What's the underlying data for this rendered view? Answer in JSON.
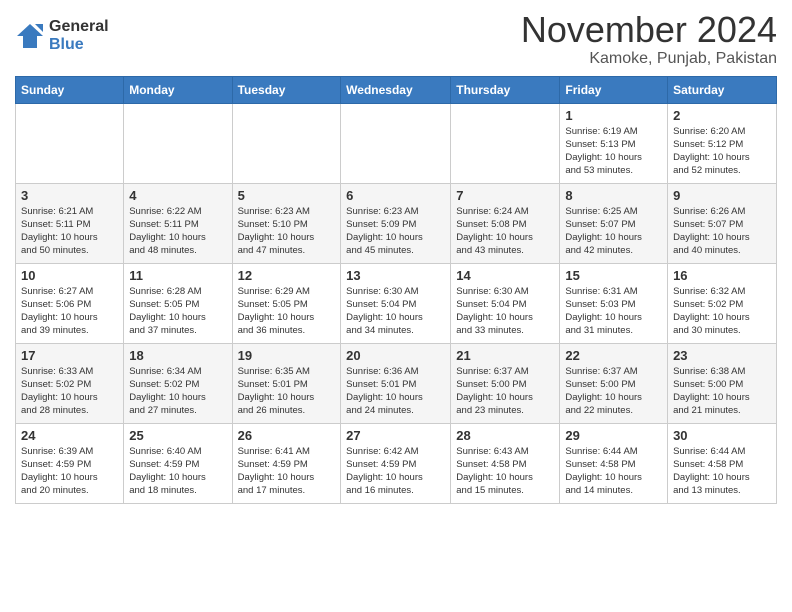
{
  "header": {
    "logo_general": "General",
    "logo_blue": "Blue",
    "month_title": "November 2024",
    "location": "Kamoke, Punjab, Pakistan"
  },
  "calendar": {
    "headers": [
      "Sunday",
      "Monday",
      "Tuesday",
      "Wednesday",
      "Thursday",
      "Friday",
      "Saturday"
    ],
    "rows": [
      [
        {
          "day": "",
          "info": ""
        },
        {
          "day": "",
          "info": ""
        },
        {
          "day": "",
          "info": ""
        },
        {
          "day": "",
          "info": ""
        },
        {
          "day": "",
          "info": ""
        },
        {
          "day": "1",
          "info": "Sunrise: 6:19 AM\nSunset: 5:13 PM\nDaylight: 10 hours\nand 53 minutes."
        },
        {
          "day": "2",
          "info": "Sunrise: 6:20 AM\nSunset: 5:12 PM\nDaylight: 10 hours\nand 52 minutes."
        }
      ],
      [
        {
          "day": "3",
          "info": "Sunrise: 6:21 AM\nSunset: 5:11 PM\nDaylight: 10 hours\nand 50 minutes."
        },
        {
          "day": "4",
          "info": "Sunrise: 6:22 AM\nSunset: 5:11 PM\nDaylight: 10 hours\nand 48 minutes."
        },
        {
          "day": "5",
          "info": "Sunrise: 6:23 AM\nSunset: 5:10 PM\nDaylight: 10 hours\nand 47 minutes."
        },
        {
          "day": "6",
          "info": "Sunrise: 6:23 AM\nSunset: 5:09 PM\nDaylight: 10 hours\nand 45 minutes."
        },
        {
          "day": "7",
          "info": "Sunrise: 6:24 AM\nSunset: 5:08 PM\nDaylight: 10 hours\nand 43 minutes."
        },
        {
          "day": "8",
          "info": "Sunrise: 6:25 AM\nSunset: 5:07 PM\nDaylight: 10 hours\nand 42 minutes."
        },
        {
          "day": "9",
          "info": "Sunrise: 6:26 AM\nSunset: 5:07 PM\nDaylight: 10 hours\nand 40 minutes."
        }
      ],
      [
        {
          "day": "10",
          "info": "Sunrise: 6:27 AM\nSunset: 5:06 PM\nDaylight: 10 hours\nand 39 minutes."
        },
        {
          "day": "11",
          "info": "Sunrise: 6:28 AM\nSunset: 5:05 PM\nDaylight: 10 hours\nand 37 minutes."
        },
        {
          "day": "12",
          "info": "Sunrise: 6:29 AM\nSunset: 5:05 PM\nDaylight: 10 hours\nand 36 minutes."
        },
        {
          "day": "13",
          "info": "Sunrise: 6:30 AM\nSunset: 5:04 PM\nDaylight: 10 hours\nand 34 minutes."
        },
        {
          "day": "14",
          "info": "Sunrise: 6:30 AM\nSunset: 5:04 PM\nDaylight: 10 hours\nand 33 minutes."
        },
        {
          "day": "15",
          "info": "Sunrise: 6:31 AM\nSunset: 5:03 PM\nDaylight: 10 hours\nand 31 minutes."
        },
        {
          "day": "16",
          "info": "Sunrise: 6:32 AM\nSunset: 5:02 PM\nDaylight: 10 hours\nand 30 minutes."
        }
      ],
      [
        {
          "day": "17",
          "info": "Sunrise: 6:33 AM\nSunset: 5:02 PM\nDaylight: 10 hours\nand 28 minutes."
        },
        {
          "day": "18",
          "info": "Sunrise: 6:34 AM\nSunset: 5:02 PM\nDaylight: 10 hours\nand 27 minutes."
        },
        {
          "day": "19",
          "info": "Sunrise: 6:35 AM\nSunset: 5:01 PM\nDaylight: 10 hours\nand 26 minutes."
        },
        {
          "day": "20",
          "info": "Sunrise: 6:36 AM\nSunset: 5:01 PM\nDaylight: 10 hours\nand 24 minutes."
        },
        {
          "day": "21",
          "info": "Sunrise: 6:37 AM\nSunset: 5:00 PM\nDaylight: 10 hours\nand 23 minutes."
        },
        {
          "day": "22",
          "info": "Sunrise: 6:37 AM\nSunset: 5:00 PM\nDaylight: 10 hours\nand 22 minutes."
        },
        {
          "day": "23",
          "info": "Sunrise: 6:38 AM\nSunset: 5:00 PM\nDaylight: 10 hours\nand 21 minutes."
        }
      ],
      [
        {
          "day": "24",
          "info": "Sunrise: 6:39 AM\nSunset: 4:59 PM\nDaylight: 10 hours\nand 20 minutes."
        },
        {
          "day": "25",
          "info": "Sunrise: 6:40 AM\nSunset: 4:59 PM\nDaylight: 10 hours\nand 18 minutes."
        },
        {
          "day": "26",
          "info": "Sunrise: 6:41 AM\nSunset: 4:59 PM\nDaylight: 10 hours\nand 17 minutes."
        },
        {
          "day": "27",
          "info": "Sunrise: 6:42 AM\nSunset: 4:59 PM\nDaylight: 10 hours\nand 16 minutes."
        },
        {
          "day": "28",
          "info": "Sunrise: 6:43 AM\nSunset: 4:58 PM\nDaylight: 10 hours\nand 15 minutes."
        },
        {
          "day": "29",
          "info": "Sunrise: 6:44 AM\nSunset: 4:58 PM\nDaylight: 10 hours\nand 14 minutes."
        },
        {
          "day": "30",
          "info": "Sunrise: 6:44 AM\nSunset: 4:58 PM\nDaylight: 10 hours\nand 13 minutes."
        }
      ]
    ]
  }
}
